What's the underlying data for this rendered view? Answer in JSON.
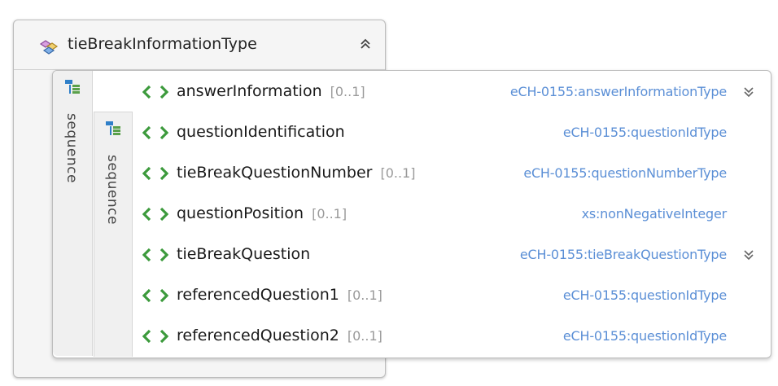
{
  "complex_type": {
    "name": "tieBreakInformationType",
    "icon": "complex-type-icon",
    "toggle_icon": "collapse-up-icon"
  },
  "sequences": [
    {
      "label": "sequence",
      "icon": "sequence-icon"
    },
    {
      "label": "sequence",
      "icon": "sequence-icon"
    }
  ],
  "elements": [
    {
      "name": "answerInformation",
      "cardinality": "[0..1]",
      "type": "eCH-0155:answerInformationType",
      "expandable": true
    },
    {
      "name": "questionIdentification",
      "cardinality": "",
      "type": "eCH-0155:questionIdType",
      "expandable": false
    },
    {
      "name": "tieBreakQuestionNumber",
      "cardinality": "[0..1]",
      "type": "eCH-0155:questionNumberType",
      "expandable": false
    },
    {
      "name": "questionPosition",
      "cardinality": "[0..1]",
      "type": "xs:nonNegativeInteger",
      "expandable": false
    },
    {
      "name": "tieBreakQuestion",
      "cardinality": "",
      "type": "eCH-0155:tieBreakQuestionType",
      "expandable": true
    },
    {
      "name": "referencedQuestion1",
      "cardinality": "[0..1]",
      "type": "eCH-0155:questionIdType",
      "expandable": false
    },
    {
      "name": "referencedQuestion2",
      "cardinality": "[0..1]",
      "type": "eCH-0155:questionIdType",
      "expandable": false
    }
  ],
  "colors": {
    "element_icon": "#3c9a3c",
    "type_link": "#5b8fd6",
    "sequence_icon": "#2f7fc8"
  }
}
